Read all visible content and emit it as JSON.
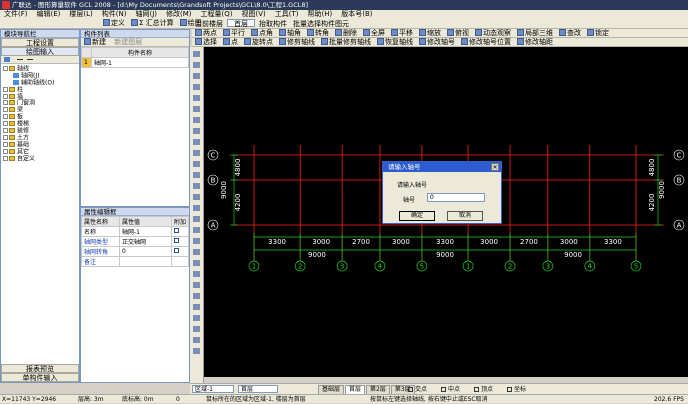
{
  "window": {
    "title": "广联达 - 图形算量软件 GCL 2008 - [d:\\My Documents\\Grandsoft Projects\\GCL\\8.0\\工程1.GCL8]"
  },
  "menu": [
    "文件(F)",
    "编辑(E)",
    "楼层(L)",
    "构件(N)",
    "轴网(J)",
    "修改(M)",
    "工程量(Q)",
    "视图(V)",
    "工具(T)",
    "帮助(H)",
    "版本号(B)"
  ],
  "toolbar1": {
    "items": [
      "定义",
      "Σ 汇总计算",
      "绘图"
    ],
    "right_items": [
      "当前楼层",
      "首层",
      "抬取构件",
      "批量选择构件图元"
    ]
  },
  "toolbar2": {
    "items": [
      "两点",
      "平行",
      "点角",
      "轴角",
      "转角",
      "删除",
      "全屏",
      "平移",
      "缩放",
      "俯视",
      "动态观察",
      "局部三维",
      "查改",
      "锁定"
    ]
  },
  "toolbar3": {
    "items": [
      "选择",
      "点",
      "旋转点",
      "修剪轴线",
      "批量修剪轴线",
      "恢复轴线",
      "修改轴号",
      "修改轴号位置",
      "修改轴距"
    ]
  },
  "left_nav": {
    "title": "模块导航栏",
    "btn_project": "工程设置",
    "btn_draw": "绘图输入",
    "tree": [
      {
        "label": "轴线",
        "level": 0,
        "type": "folder",
        "open": true
      },
      {
        "label": "轴网(J)",
        "level": 1,
        "type": "item"
      },
      {
        "label": "辅助轴线(O)",
        "level": 1,
        "type": "item"
      },
      {
        "label": "柱",
        "level": 0,
        "type": "folder"
      },
      {
        "label": "墙",
        "level": 0,
        "type": "folder"
      },
      {
        "label": "门窗洞",
        "level": 0,
        "type": "folder"
      },
      {
        "label": "梁",
        "level": 0,
        "type": "folder"
      },
      {
        "label": "板",
        "level": 0,
        "type": "folder"
      },
      {
        "label": "楼梯",
        "level": 0,
        "type": "folder"
      },
      {
        "label": "装修",
        "level": 0,
        "type": "folder"
      },
      {
        "label": "土方",
        "level": 0,
        "type": "folder"
      },
      {
        "label": "基础",
        "level": 0,
        "type": "folder"
      },
      {
        "label": "其它",
        "level": 0,
        "type": "folder"
      },
      {
        "label": "自定义",
        "level": 0,
        "type": "folder"
      }
    ],
    "btn_report": "报表预览",
    "btn_sheet": "单构件输入"
  },
  "comp_list": {
    "title": "构件列表",
    "new_btn": "新建",
    "new_layer_btn": "新建图层",
    "col_name": "构件名称",
    "rows": [
      {
        "idx": "1",
        "name": "轴网-1"
      }
    ]
  },
  "props": {
    "title": "属性编辑框",
    "col_name": "属性名称",
    "col_value": "属性值",
    "col_attach": "附加",
    "rows": [
      {
        "name": "名称",
        "value": "轴网-1"
      },
      {
        "name": "轴网类型",
        "value": "正交轴网"
      },
      {
        "name": "轴网转角",
        "value": "0"
      },
      {
        "name": "备注",
        "value": ""
      }
    ]
  },
  "drawing": {
    "axis_letters": [
      "C",
      "B",
      "A"
    ],
    "vert_dims_left": [
      "4800",
      "4200"
    ],
    "vert_total_left": "9000",
    "vert_dims_right": [
      "4800",
      "4200"
    ],
    "vert_total_right": "9000",
    "horiz_dims": [
      "3300",
      "3000",
      "2700",
      "3000",
      "3300",
      "3000",
      "2700",
      "3000",
      "3300"
    ],
    "horiz_totals": [
      "9000",
      "9000",
      "9000"
    ],
    "axis_numbers": [
      "1",
      "2",
      "3",
      "4",
      "5",
      "1",
      "2",
      "3",
      "4",
      "5"
    ]
  },
  "dialog": {
    "title": "请输入轴号",
    "prompt": "请输入轴号",
    "field_label": "轴号",
    "field_value": "0",
    "ok": "确定",
    "cancel": "取消"
  },
  "bottombar": {
    "layer_select": "区域-1",
    "floor_select": "首层",
    "tabs": [
      "基础层",
      "首层",
      "第2层",
      "第3层"
    ],
    "snap_items": [
      "交点",
      "中点",
      "顶点",
      "坐标"
    ]
  },
  "status": {
    "coords": "X=11743 Y=2946",
    "floor_height": "层高: 3m",
    "base_elev": "底标高: 0m",
    "value_zero": "0",
    "hint": "鼠标所在的区域为区域-1, 楼层为首层",
    "hint2": "按鼠标左键选择轴线, 按右键中止或ESC取消",
    "fps": "202.6 FPS"
  },
  "colors": {
    "canvas_bg": "#000000",
    "grid_red": "#ff2020",
    "grid_green": "#20d020",
    "dim_text": "#ffffff",
    "dialog_title": "#2d5ccf"
  }
}
